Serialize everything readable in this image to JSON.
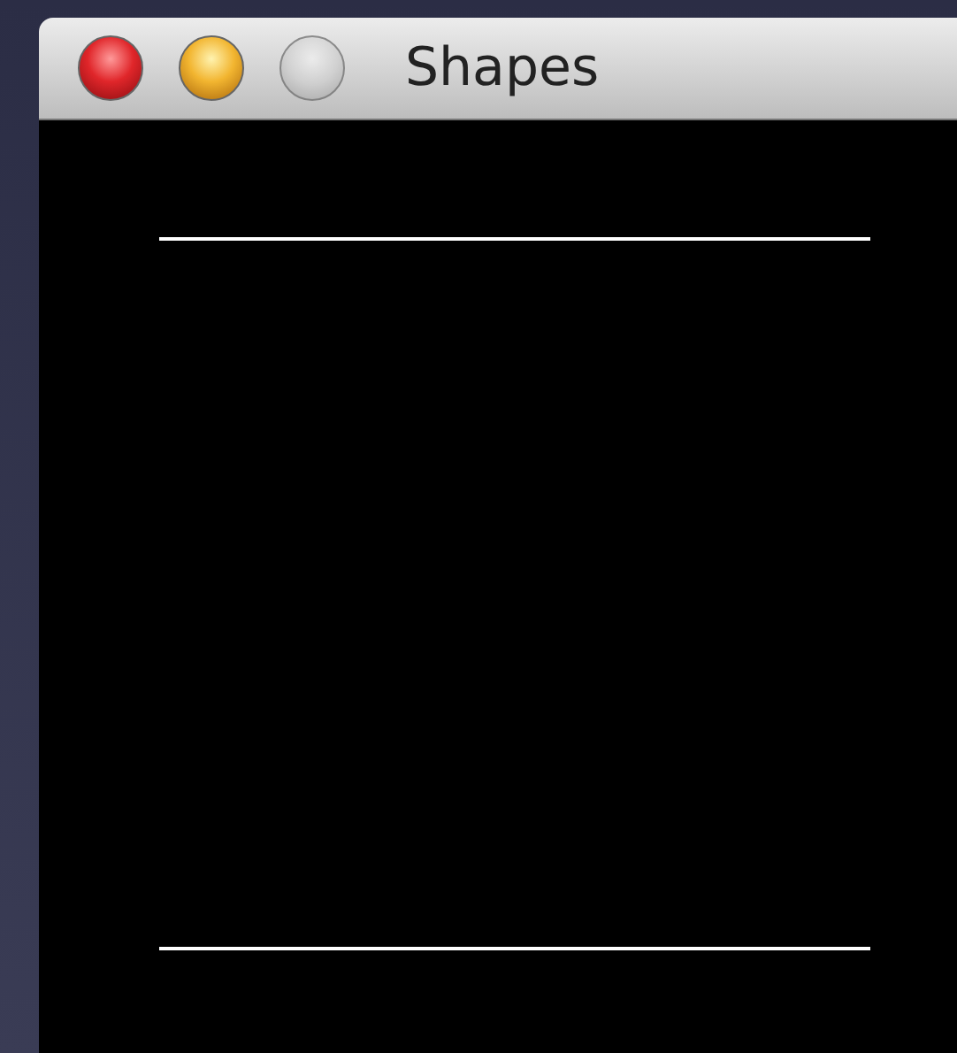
{
  "window": {
    "title": "Shapes",
    "buttons": [
      {
        "kind": "close",
        "disabled": false
      },
      {
        "kind": "minimize",
        "disabled": false
      },
      {
        "kind": "zoom",
        "disabled": true
      }
    ]
  }
}
